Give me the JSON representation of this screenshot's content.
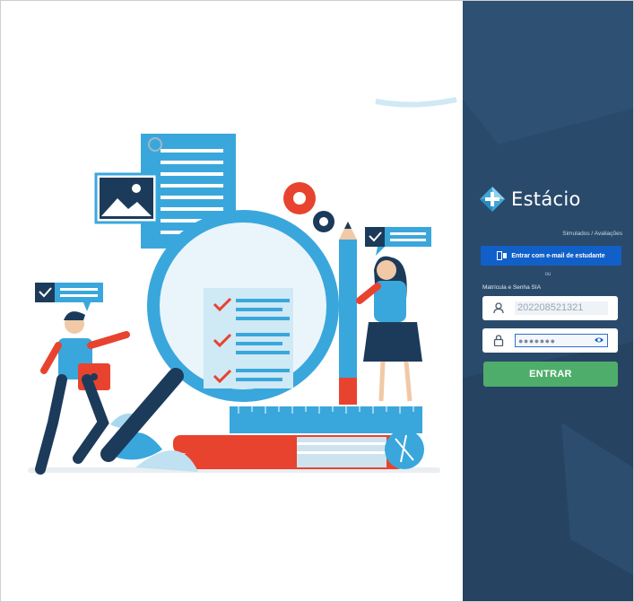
{
  "brand": {
    "name": "Estácio",
    "accent": "#4fad6b",
    "panel_bg": "#2a4a6b",
    "button_blue": "#1160c9"
  },
  "header": {
    "links": "Simulados / Avaliações"
  },
  "login": {
    "email_button_label": "Entrar com e-mail de estudante",
    "divider_text": "ou",
    "section_label": "Matrícula e Senha SIA",
    "username_value": "202208521321",
    "password_value": "●●●●●●●",
    "submit_label": "ENTRAR"
  },
  "icons": {
    "email": "microsoft-badge-icon",
    "user": "user-icon",
    "lock": "lock-icon",
    "eye": "eye-icon",
    "logo": "estacio-diamond-logo"
  }
}
